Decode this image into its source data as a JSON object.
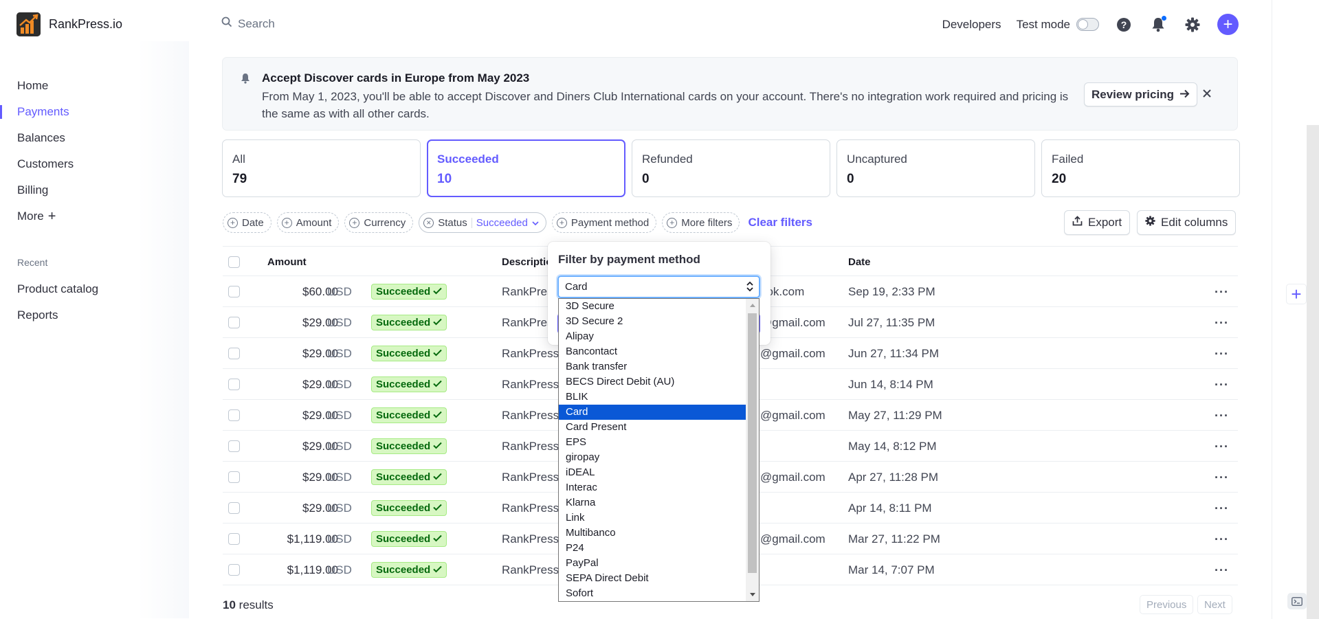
{
  "brand": {
    "name": "RankPress.io"
  },
  "sidebar": {
    "items": [
      {
        "label": "Home"
      },
      {
        "label": "Payments"
      },
      {
        "label": "Balances"
      },
      {
        "label": "Customers"
      },
      {
        "label": "Billing"
      },
      {
        "label": "More"
      }
    ],
    "recent_title": "Recent",
    "recent": [
      {
        "label": "Product catalog"
      },
      {
        "label": "Reports"
      }
    ]
  },
  "topbar": {
    "search_placeholder": "Search",
    "developers": "Developers",
    "test_mode": "Test mode"
  },
  "banner": {
    "title": "Accept Discover cards in Europe from May 2023",
    "body": "From May 1, 2023, you'll be able to accept Discover and Diners Club International cards on your account. There's no integration work required and pricing is the same as with all other cards.",
    "button": "Review pricing"
  },
  "stats": [
    {
      "label": "All",
      "count": "79"
    },
    {
      "label": "Succeeded",
      "count": "10"
    },
    {
      "label": "Refunded",
      "count": "0"
    },
    {
      "label": "Uncaptured",
      "count": "0"
    },
    {
      "label": "Failed",
      "count": "20"
    }
  ],
  "filters": {
    "date": "Date",
    "amount": "Amount",
    "currency": "Currency",
    "status": "Status",
    "status_value": "Succeeded",
    "payment_method": "Payment method",
    "more": "More filters",
    "clear": "Clear filters",
    "export": "Export",
    "edit_columns": "Edit columns"
  },
  "table": {
    "headers": {
      "amount": "Amount",
      "description": "Description",
      "date": "Date"
    },
    "rows": [
      {
        "amount": "$60.00",
        "currency": "USD",
        "status": "Succeeded",
        "description": "RankPres",
        "customer": "ook.com",
        "date": "Sep 19, 2:33 PM"
      },
      {
        "amount": "$29.00",
        "currency": "USD",
        "status": "Succeeded",
        "description": "RankPres",
        "customer": "@gmail.com",
        "date": "Jul 27, 11:35 PM"
      },
      {
        "amount": "$29.00",
        "currency": "USD",
        "status": "Succeeded",
        "description": "RankPress.",
        "customer": "@gmail.com",
        "date": "Jun 27, 11:34 PM"
      },
      {
        "amount": "$29.00",
        "currency": "USD",
        "status": "Succeeded",
        "description": "RankPress.",
        "customer": "",
        "date": "Jun 14, 8:14 PM"
      },
      {
        "amount": "$29.00",
        "currency": "USD",
        "status": "Succeeded",
        "description": "RankPress.",
        "customer": "@gmail.com",
        "date": "May 27, 11:29 PM"
      },
      {
        "amount": "$29.00",
        "currency": "USD",
        "status": "Succeeded",
        "description": "RankPress.",
        "customer": "",
        "date": "May 14, 8:12 PM"
      },
      {
        "amount": "$29.00",
        "currency": "USD",
        "status": "Succeeded",
        "description": "RankPress.",
        "customer": "@gmail.com",
        "date": "Apr 27, 11:28 PM"
      },
      {
        "amount": "$29.00",
        "currency": "USD",
        "status": "Succeeded",
        "description": "RankPress.",
        "customer": "",
        "date": "Apr 14, 8:11 PM"
      },
      {
        "amount": "$1,119.00",
        "currency": "USD",
        "status": "Succeeded",
        "description": "RankPress.",
        "customer": "@gmail.com",
        "date": "Mar 27, 11:22 PM"
      },
      {
        "amount": "$1,119.00",
        "currency": "USD",
        "status": "Succeeded",
        "description": "RankPress.",
        "customer": "",
        "date": "Mar 14, 7:07 PM"
      }
    ],
    "results_count": "10",
    "results_label": "results",
    "previous": "Previous",
    "next": "Next"
  },
  "popover": {
    "title": "Filter by payment method",
    "selected": "Card",
    "options": [
      "3D Secure",
      "3D Secure 2",
      "Alipay",
      "Bancontact",
      "Bank transfer",
      "BECS Direct Debit (AU)",
      "BLIK",
      "Card",
      "Card Present",
      "EPS",
      "giropay",
      "iDEAL",
      "Interac",
      "Klarna",
      "Link",
      "Multibanco",
      "P24",
      "PayPal",
      "SEPA Direct Debit",
      "Sofort"
    ]
  },
  "colors": {
    "accent": "#635bff",
    "success_bg": "#d7f7c2",
    "success_text": "#05690d"
  }
}
